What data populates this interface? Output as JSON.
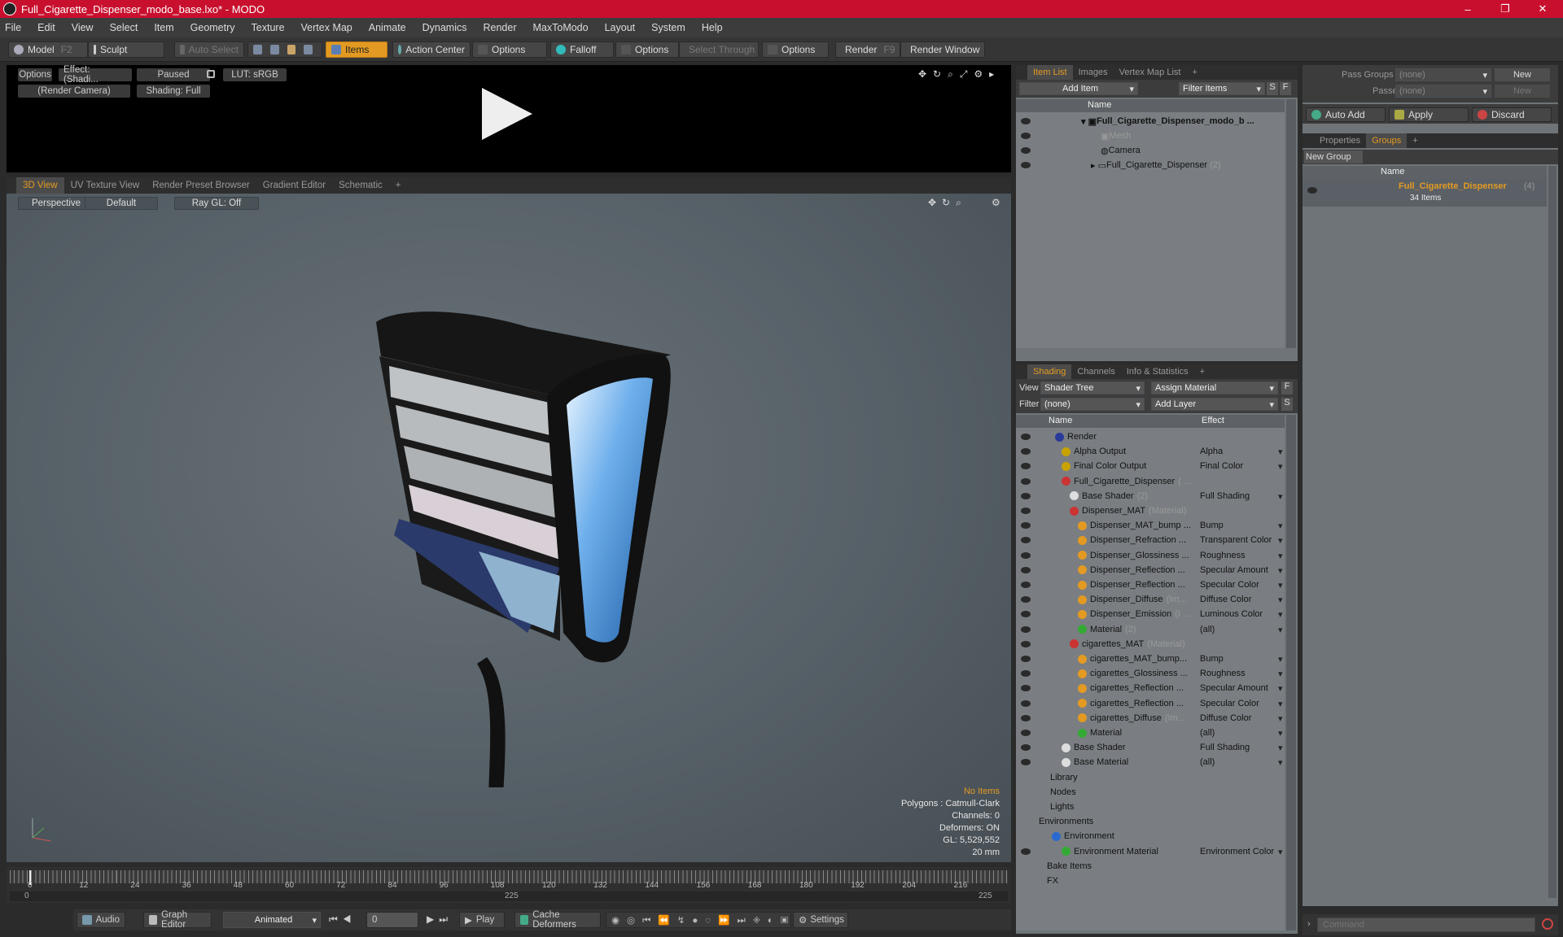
{
  "window": {
    "title": "Full_Cigarette_Dispenser_modo_base.lxo* - MODO",
    "min": "–",
    "max": "❐",
    "close": "✕"
  },
  "menu": [
    "File",
    "Edit",
    "View",
    "Select",
    "Item",
    "Geometry",
    "Texture",
    "Vertex Map",
    "Animate",
    "Dynamics",
    "Render",
    "MaxToModo",
    "Layout",
    "System",
    "Help"
  ],
  "toolbar": {
    "model": "Model",
    "model_key": "F2",
    "sculpt": "Sculpt",
    "auto_select": "Auto Select",
    "items": "Items",
    "action_center": "Action Center",
    "options1": "Options",
    "falloff": "Falloff",
    "options2": "Options",
    "select_through": "Select Through",
    "options3": "Options",
    "render": "Render",
    "render_key": "F9",
    "render_window": "Render Window"
  },
  "preview": {
    "options": "Options",
    "effect": "Effect: (Shadi...",
    "paused": "Paused",
    "lut": "LUT: sRGB",
    "camera": "(Render Camera)",
    "shading": "Shading: Full"
  },
  "viewport_tabs": [
    "3D View",
    "UV Texture View",
    "Render Preset Browser",
    "Gradient Editor",
    "Schematic",
    "+"
  ],
  "viewport": {
    "perspective": "Perspective",
    "default": "Default",
    "raygl": "Ray GL: Off",
    "info": {
      "no_items": "No Items",
      "polygons": "Polygons : Catmull-Clark",
      "channels": "Channels: 0",
      "deformers": "Deformers: ON",
      "gl": "GL: 5,529,552",
      "scale": "20 mm"
    }
  },
  "timeline": {
    "ticks": [
      "0",
      "12",
      "24",
      "36",
      "48",
      "60",
      "72",
      "84",
      "96",
      "108",
      "120",
      "132",
      "144",
      "156",
      "168",
      "180",
      "192",
      "204",
      "216"
    ],
    "start": "0",
    "mid": "225",
    "end": "225"
  },
  "bottom": {
    "audio": "Audio",
    "graph_editor": "Graph Editor",
    "animated": "Animated",
    "frame": "0",
    "play": "Play",
    "cache": "Cache Deformers",
    "settings": "Settings"
  },
  "item_list": {
    "tabs": [
      "Item List",
      "Images",
      "Vertex Map List",
      "+"
    ],
    "add_item": "Add Item",
    "filter": "Filter Items",
    "s": "S",
    "f": "F",
    "name_col": "Name",
    "items": [
      {
        "label": "Full_Cigarette_Dispenser_modo_b ...",
        "extra": ""
      },
      {
        "label": "Mesh",
        "extra": ""
      },
      {
        "label": "Camera",
        "extra": ""
      },
      {
        "label": "Full_Cigarette_Dispenser",
        "extra": "(2)"
      }
    ]
  },
  "shading": {
    "tabs": [
      "Shading",
      "Channels",
      "Info & Statistics",
      "+"
    ],
    "view_label": "View",
    "view_value": "Shader Tree",
    "assign": "Assign Material",
    "filter_label": "Filter",
    "filter_value": "(none)",
    "add_layer": "Add Layer",
    "f": "F",
    "s": "S",
    "name_col": "Name",
    "effect_col": "Effect",
    "rows": [
      {
        "name": "Render",
        "note": "",
        "effect": ""
      },
      {
        "name": "Alpha Output",
        "note": "",
        "effect": "Alpha"
      },
      {
        "name": "Final Color Output",
        "note": "",
        "effect": "Final Color"
      },
      {
        "name": "Full_Cigarette_Dispenser",
        "note": "( ...",
        "effect": ""
      },
      {
        "name": "Base Shader",
        "note": "(2)",
        "effect": "Full Shading"
      },
      {
        "name": "Dispenser_MAT",
        "note": "(Material)",
        "effect": ""
      },
      {
        "name": "Dispenser_MAT_bump ...",
        "note": "",
        "effect": "Bump"
      },
      {
        "name": "Dispenser_Refraction ...",
        "note": "",
        "effect": "Transparent Color"
      },
      {
        "name": "Dispenser_Glossiness ...",
        "note": "",
        "effect": "Roughness"
      },
      {
        "name": "Dispenser_Reflection ...",
        "note": "",
        "effect": "Specular Amount"
      },
      {
        "name": "Dispenser_Reflection ...",
        "note": "",
        "effect": "Specular Color"
      },
      {
        "name": "Dispenser_Diffuse",
        "note": "(Im...",
        "effect": "Diffuse Color"
      },
      {
        "name": "Dispenser_Emission",
        "note": "(I ...",
        "effect": "Luminous Color"
      },
      {
        "name": "Material",
        "note": "(2)",
        "effect": "(all)"
      },
      {
        "name": "cigarettes_MAT",
        "note": "(Material)",
        "effect": ""
      },
      {
        "name": "cigarettes_MAT_bump...",
        "note": "",
        "effect": "Bump"
      },
      {
        "name": "cigarettes_Glossiness ...",
        "note": "",
        "effect": "Roughness"
      },
      {
        "name": "cigarettes_Reflection ...",
        "note": "",
        "effect": "Specular Amount"
      },
      {
        "name": "cigarettes_Reflection ...",
        "note": "",
        "effect": "Specular Color"
      },
      {
        "name": "cigarettes_Diffuse",
        "note": "(Im...",
        "effect": "Diffuse Color"
      },
      {
        "name": "Material",
        "note": "",
        "effect": "(all)"
      },
      {
        "name": "Base Shader",
        "note": "",
        "effect": "Full Shading"
      },
      {
        "name": "Base Material",
        "note": "",
        "effect": "(all)"
      },
      {
        "name": "Library",
        "note": "",
        "effect": ""
      },
      {
        "name": "Nodes",
        "note": "",
        "effect": ""
      },
      {
        "name": "Lights",
        "note": "",
        "effect": ""
      },
      {
        "name": "Environments",
        "note": "",
        "effect": ""
      },
      {
        "name": "Environment",
        "note": "",
        "effect": ""
      },
      {
        "name": "Environment Material",
        "note": "",
        "effect": "Environment Color"
      },
      {
        "name": "Bake Items",
        "note": "",
        "effect": ""
      },
      {
        "name": "FX",
        "note": "",
        "effect": ""
      }
    ]
  },
  "groups": {
    "pass_groups": "Pass Groups",
    "passes": "Passes",
    "none1": "(none)",
    "none2": "(none)",
    "new1": "New",
    "new2": "New",
    "auto_add": "Auto Add",
    "apply": "Apply",
    "discard": "Discard",
    "tabs": [
      "Properties",
      "Groups",
      "+"
    ],
    "new_group": "New Group",
    "name_col": "Name",
    "group_name": "Full_Cigarette_Dispenser",
    "group_count": "(4)",
    "group_items": "34 Items"
  },
  "command": {
    "placeholder": "Command"
  },
  "colors": {
    "accent": "#e39a22",
    "title": "#c8102e"
  }
}
